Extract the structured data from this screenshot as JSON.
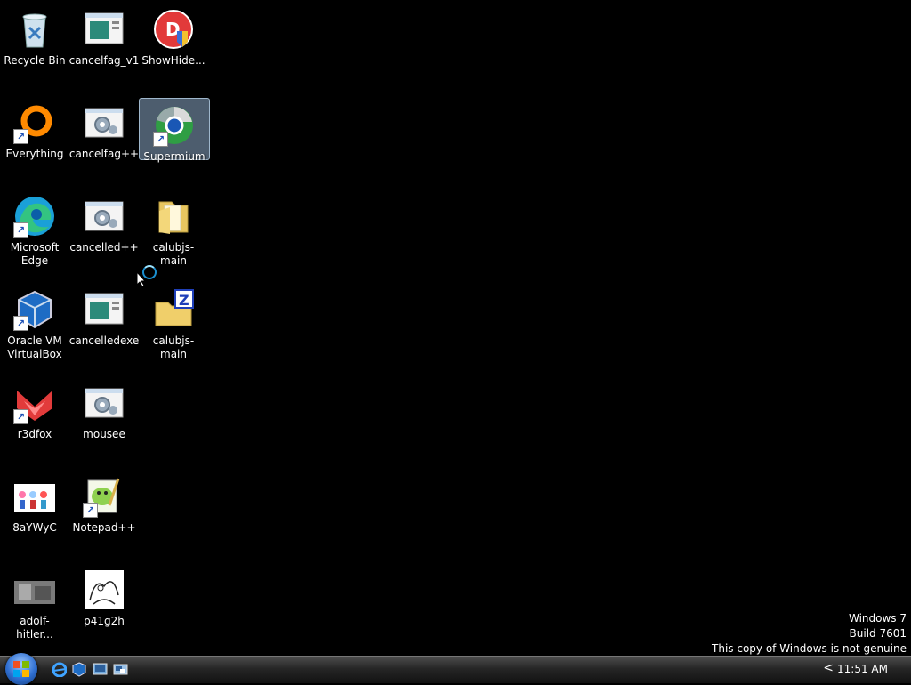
{
  "desktop": {
    "icons": [
      {
        "label": "Recycle Bin",
        "icon": "recycle-bin-icon"
      },
      {
        "label": "cancelfag_v1",
        "icon": "window-icon"
      },
      {
        "label": "ShowHide...",
        "icon": "showhide-icon"
      },
      {
        "label": "Everything",
        "icon": "everything-icon"
      },
      {
        "label": "cancelfag++",
        "icon": "gear-window-icon"
      },
      {
        "label": "Supermium",
        "icon": "supermium-icon"
      },
      {
        "label": "Microsoft Edge",
        "icon": "edge-icon"
      },
      {
        "label": "cancelled++",
        "icon": "gear-window-icon"
      },
      {
        "label": "calubjs-main",
        "icon": "folder-icon"
      },
      {
        "label": "Oracle VM VirtualBox",
        "icon": "virtualbox-icon"
      },
      {
        "label": "cancelledexe",
        "icon": "window-icon"
      },
      {
        "label": "calubjs-main",
        "icon": "zip-folder-icon"
      },
      {
        "label": "r3dfox",
        "icon": "r3dfox-icon"
      },
      {
        "label": "mousee",
        "icon": "gear-window-icon"
      },
      {
        "label": "8aYWyC",
        "icon": "image-thumbnail-icon"
      },
      {
        "label": "Notepad++",
        "icon": "notepadpp-icon"
      },
      {
        "label": "adolf-hitler...",
        "icon": "image-thumbnail-icon"
      },
      {
        "label": "p41g2h",
        "icon": "sketch-thumbnail-icon"
      }
    ],
    "selected": "Supermium"
  },
  "watermark": {
    "line1": "Windows 7",
    "line2": "Build 7601",
    "line3": "This copy of Windows is not genuine"
  },
  "taskbar": {
    "clock": "11:51 AM",
    "tray_arrow": "<",
    "quick_launch": [
      "internet-explorer-icon",
      "virtualbox-icon",
      "show-desktop-icon",
      "switch-windows-icon"
    ]
  },
  "colors": {
    "desktop": "#000000",
    "selection": "#8caac8"
  }
}
